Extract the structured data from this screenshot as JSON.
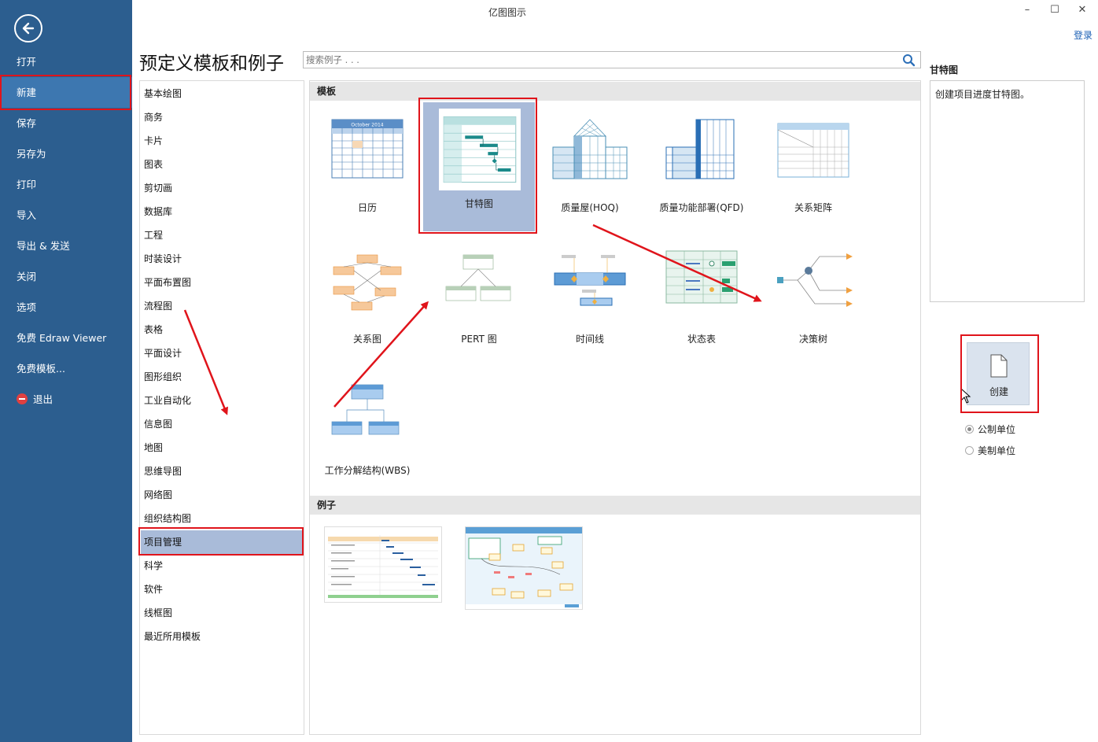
{
  "window": {
    "title": "亿图图示",
    "minimize": "–",
    "maximize": "☐",
    "close": "✕",
    "login": "登录"
  },
  "sidebar": {
    "items": [
      {
        "label": "打开"
      },
      {
        "label": "新建"
      },
      {
        "label": "保存"
      },
      {
        "label": "另存为"
      },
      {
        "label": "打印"
      },
      {
        "label": "导入"
      },
      {
        "label": "导出 & 发送"
      },
      {
        "label": "关闭"
      },
      {
        "label": "选项"
      },
      {
        "label": "免费 Edraw Viewer"
      },
      {
        "label": "免费模板..."
      },
      {
        "label": "退出"
      }
    ],
    "active_index": 1
  },
  "header": {
    "title": "预定义模板和例子",
    "search_placeholder": "搜索例子 . . ."
  },
  "categories": {
    "items": [
      "基本绘图",
      "商务",
      "卡片",
      "图表",
      "剪切画",
      "数据库",
      "工程",
      "时装设计",
      "平面布置图",
      "流程图",
      "表格",
      "平面设计",
      "图形组织",
      "工业自动化",
      "信息图",
      "地图",
      "思维导图",
      "网络图",
      "组织结构图",
      "项目管理",
      "科学",
      "软件",
      "线框图",
      "最近所用模板"
    ],
    "active_index": 19
  },
  "gallery": {
    "templates_header": "模板",
    "examples_header": "例子",
    "templates": [
      {
        "label": "日历",
        "icon": "calendar-thumb",
        "calendar_caption": "October 2014"
      },
      {
        "label": "甘特图",
        "icon": "gantt-thumb"
      },
      {
        "label": "质量屋(HOQ)",
        "icon": "hoq-thumb"
      },
      {
        "label": "质量功能部署(QFD)",
        "icon": "qfd-thumb"
      },
      {
        "label": "关系矩阵",
        "icon": "matrix-thumb"
      },
      {
        "label": "关系图",
        "icon": "relation-thumb"
      },
      {
        "label": "PERT 图",
        "icon": "pert-thumb"
      },
      {
        "label": "时间线",
        "icon": "timeline-thumb"
      },
      {
        "label": "状态表",
        "icon": "status-table-thumb"
      },
      {
        "label": "决策树",
        "icon": "decision-tree-thumb"
      },
      {
        "label": "工作分解结构(WBS)",
        "icon": "wbs-thumb"
      }
    ],
    "selected_index": 1
  },
  "detail": {
    "title": "甘特图",
    "description": "创建项目进度甘特图。",
    "create_label": "创建",
    "units": [
      {
        "label": "公制单位",
        "checked": true
      },
      {
        "label": "美制单位",
        "checked": false
      }
    ]
  },
  "colors": {
    "sidebar": "#2c5e8f",
    "sidebar_active": "#3d77b0",
    "selection": "#a9bbd9",
    "annotation_red": "#e0141b",
    "link": "#1a5fb4"
  }
}
